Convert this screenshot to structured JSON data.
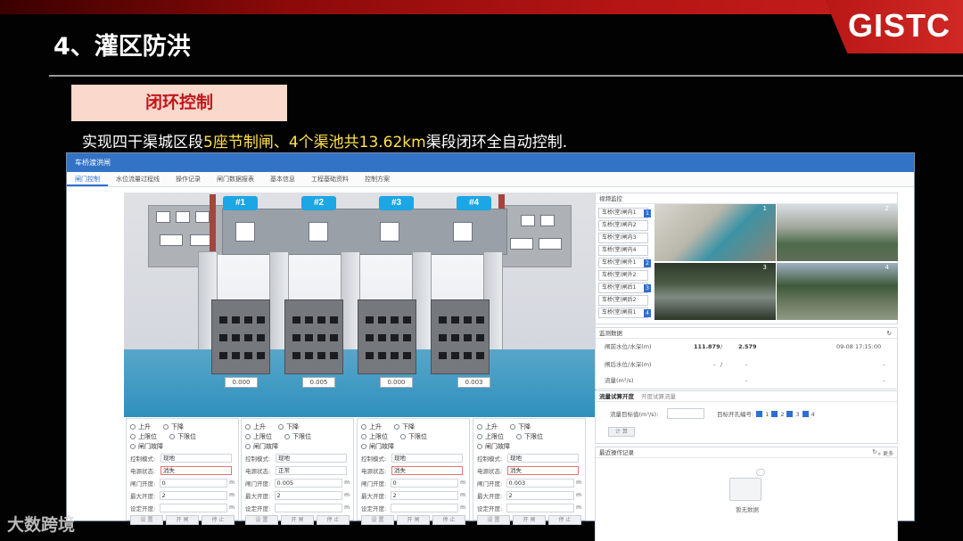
{
  "slide": {
    "title": "4、灌区防洪",
    "logo": "GISTC",
    "tag": "闭环控制",
    "subtitle_a": "实现四干渠城区段",
    "subtitle_hl": "5座节制闸、4个渠池共13.62km",
    "subtitle_b": "渠段闭环全自动控制.",
    "watermark": "大数跨境"
  },
  "app": {
    "window_title": "车桥渡洪闸",
    "tabs": [
      "闸门控制",
      "水位流量过程线",
      "操作记录",
      "闸门数据报表",
      "基本信息",
      "工程基础资料",
      "控制方案"
    ],
    "gates": [
      {
        "label": "#1",
        "value": "0.000"
      },
      {
        "label": "#2",
        "value": "0.005"
      },
      {
        "label": "#3",
        "value": "0.000"
      },
      {
        "label": "#4",
        "value": "0.003"
      }
    ],
    "panels": [
      {
        "up": "上升",
        "down": "下降",
        "upper": "上限位",
        "lower": "下限位",
        "fault": "闸门故障",
        "mode_label": "控制模式:",
        "mode": "现地",
        "power_label": "电源状态:",
        "power": "消失",
        "open_label": "闸门开度:",
        "open": "0",
        "max_label": "最大开度:",
        "max": "2",
        "set_label": "设定开度:",
        "set": "",
        "unit": "m",
        "b1": "设 置",
        "b2": "开 闸",
        "b3": "停 止"
      },
      {
        "up": "上升",
        "down": "下降",
        "upper": "上限位",
        "lower": "下限位",
        "fault": "闸门故障",
        "mode_label": "控制模式:",
        "mode": "现地",
        "power_label": "电源状态:",
        "power": "正常",
        "open_label": "闸门开度:",
        "open": "0.005",
        "max_label": "最大开度:",
        "max": "2",
        "set_label": "设定开度:",
        "set": "",
        "unit": "m",
        "b1": "设 置",
        "b2": "开 闸",
        "b3": "停 止"
      },
      {
        "up": "上升",
        "down": "下降",
        "upper": "上限位",
        "lower": "下限位",
        "fault": "闸门故障",
        "mode_label": "控制模式:",
        "mode": "现地",
        "power_label": "电源状态:",
        "power": "消失",
        "open_label": "闸门开度:",
        "open": "0",
        "max_label": "最大开度:",
        "max": "2",
        "set_label": "设定开度:",
        "set": "",
        "unit": "m",
        "b1": "设 置",
        "b2": "开 闸",
        "b3": "停 止"
      },
      {
        "up": "上升",
        "down": "下降",
        "upper": "上限位",
        "lower": "下限位",
        "fault": "闸门故障",
        "mode_label": "控制模式:",
        "mode": "现地",
        "power_label": "电源状态:",
        "power": "消失",
        "open_label": "闸门开度:",
        "open": "0.003",
        "max_label": "最大开度:",
        "max": "2",
        "set_label": "设定开度:",
        "set": "",
        "unit": "m",
        "b1": "设 置",
        "b2": "开 闸",
        "b3": "停 止"
      }
    ],
    "video": {
      "title": "视频监控",
      "cameras": [
        {
          "name": "车桥(堂)闸内1",
          "num": "1"
        },
        {
          "name": "车桥(堂)闸内2",
          "num": ""
        },
        {
          "name": "车桥(堂)闸内3",
          "num": ""
        },
        {
          "name": "车桥(堂)闸内4",
          "num": ""
        },
        {
          "name": "车桥(堂)闸外1",
          "num": "2"
        },
        {
          "name": "车桥(堂)闸外2",
          "num": ""
        },
        {
          "name": "车桥(堂)闸后1",
          "num": "3"
        },
        {
          "name": "车桥(堂)闸后2",
          "num": ""
        },
        {
          "name": "车桥(堂)闸前1",
          "num": "4"
        }
      ],
      "tiles": [
        "1",
        "2",
        "3",
        "4"
      ]
    },
    "monitor": {
      "title": "监测数据",
      "r1_label": "闸前水位/水深(m)",
      "r1_v1": "111.879",
      "r1_sep": "/",
      "r1_v2": "2.579",
      "r1_time": "09-08 17:15:00",
      "r2_label": "闸后水位/水深(m)",
      "r2_v1": "-",
      "r2_sep": "/",
      "r2_v2": "-",
      "r2_time": "-",
      "r3_label": "流量(m³/s)",
      "r3_v": "-",
      "r3_time": "-"
    },
    "trial": {
      "tab1": "流量试算开度",
      "tab2": "开度试算流量",
      "target_label": "流量目标值(m³/s):",
      "gates_label": "目标开孔编号:",
      "checks": [
        "1",
        "2",
        "3",
        "4"
      ],
      "btn": "计 算"
    },
    "ops": {
      "title": "最近操作记录",
      "more": "» 更多",
      "empty": "暂无数据"
    }
  }
}
